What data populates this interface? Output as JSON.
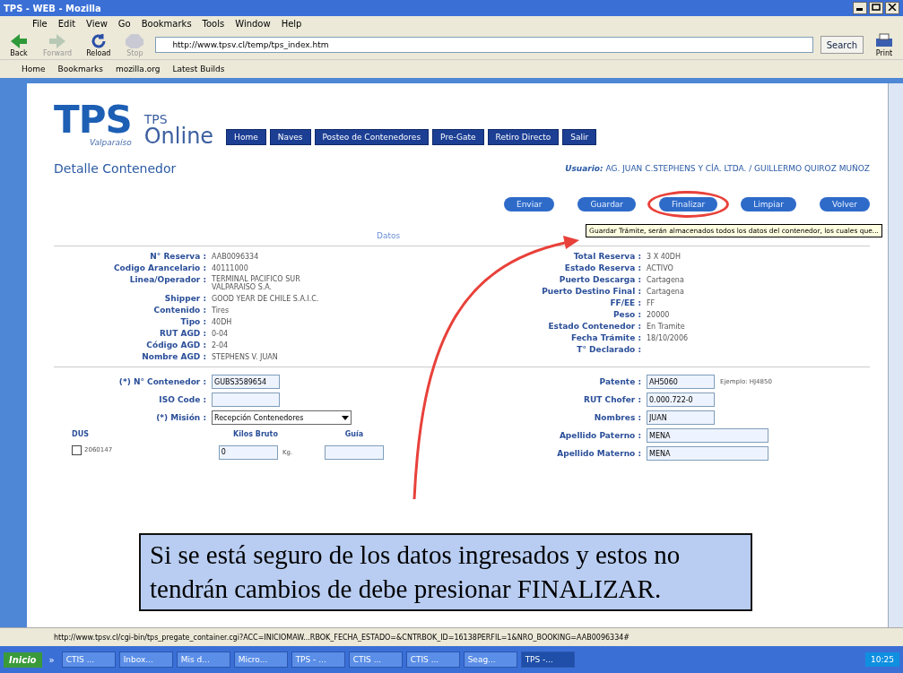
{
  "window": {
    "title": "TPS - WEB - Mozilla"
  },
  "menu": [
    "File",
    "Edit",
    "View",
    "Go",
    "Bookmarks",
    "Tools",
    "Window",
    "Help"
  ],
  "toolbar": {
    "buttons": [
      {
        "label": "Back",
        "kind": "back",
        "disabled": false
      },
      {
        "label": "Forward",
        "kind": "forward",
        "disabled": true
      },
      {
        "label": "Reload",
        "kind": "reload",
        "disabled": false
      },
      {
        "label": "Stop",
        "kind": "stop",
        "disabled": true
      }
    ],
    "url": "http://www.tpsv.cl/temp/tps_index.htm",
    "search": "Search",
    "print": "Print"
  },
  "bookmarks": [
    "Home",
    "Bookmarks",
    "mozilla.org",
    "Latest Builds"
  ],
  "page": {
    "logo": {
      "brand": "TPS",
      "city": "Valparaíso",
      "product_top": "TPS",
      "product_bottom": "Online"
    },
    "nav": [
      "Home",
      "Naves",
      "Posteo de Contenedores",
      "Pre-Gate",
      "Retiro Directo",
      "Salir"
    ],
    "heading": "Detalle Contenedor",
    "user": "**Usuario:** AG. JUAN C.STEPHENS Y CÍA. LTDA. / GUILLERMO QUIROZ MUÑOZ",
    "actions": [
      {
        "label": "Enviar",
        "circled": false
      },
      {
        "label": "Guardar",
        "circled": false
      },
      {
        "label": "Finalizar",
        "circled": true
      },
      {
        "label": "Limpiar",
        "circled": false
      },
      {
        "label": "Volver",
        "circled": false
      }
    ],
    "tooltip": "Guardar Trámite, serán almacenados todos los datos del contenedor, los cuales que...",
    "section": "Datos",
    "details_left": [
      {
        "label": "N° Reserva :",
        "value": "AAB0096334"
      },
      {
        "label": "Codigo Arancelario :",
        "value": "40111000"
      },
      {
        "label": "Linea/Operador :",
        "value": "TERMINAL PACIFICO SUR VALPARAISO S.A."
      },
      {
        "label": "Shipper :",
        "value": "GOOD YEAR DE CHILE S.A.I.C."
      },
      {
        "label": "Contenido :",
        "value": "Tires"
      },
      {
        "label": "Tipo :",
        "value": "40DH"
      },
      {
        "label": "RUT AGD :",
        "value": "0-04"
      },
      {
        "label": "Código AGD :",
        "value": "2-04"
      },
      {
        "label": "Nombre AGD :",
        "value": "STEPHENS V. JUAN"
      }
    ],
    "details_right": [
      {
        "label": "Total Reserva :",
        "value": "3 X 40DH"
      },
      {
        "label": "Estado Reserva :",
        "value": "ACTIVO"
      },
      {
        "label": "Puerto Descarga :",
        "value": "Cartagena"
      },
      {
        "label": "Puerto Destino Final :",
        "value": "Cartagena"
      },
      {
        "label": "FF/EE :",
        "value": "FF"
      },
      {
        "label": "Peso :",
        "value": "20000"
      },
      {
        "label": "Estado Contenedor :",
        "value": "En Tramite"
      },
      {
        "label": "Fecha Trámite :",
        "value": "18/10/2006"
      },
      {
        "label": "T° Declarado :"
      }
    ],
    "form_left": [
      {
        "label": "(*) N° Contenedor :",
        "kind": "input",
        "value": "GUBS3589654"
      },
      {
        "label": "ISO Code :",
        "kind": "input"
      },
      {
        "label": "(*) Misión :",
        "kind": "select",
        "value": "Recepción Contenedores"
      }
    ],
    "form_right": [
      {
        "label": "Patente :",
        "value": "AH5060",
        "hint": "Ejemplo: HJ4850"
      },
      {
        "label": "RUT Chofer :",
        "value": "0.000.722-0"
      },
      {
        "label": "Nombres :",
        "value": "JUAN"
      },
      {
        "label": "Apellido Paterno :",
        "value": "MENA"
      },
      {
        "label": "Apellido Materno :",
        "value": "MENA"
      }
    ],
    "dus": {
      "header": "DUS",
      "kilos_header": "Kilos Bruto",
      "guia_header": "Guía",
      "item": "2060147",
      "checked": false,
      "kilos": "0",
      "unit": "Kg."
    }
  },
  "caption": "Si se está seguro de los datos ingresados y estos no tendrán cambios de debe presionar FINALIZAR.",
  "status_bar": "http://www.tpsv.cl/cgi-bin/tps_pregate_container.cgi?ACC=INICIOMAW...RBOK_FECHA_ESTADO=&CNTRBOK_ID=16138PERFIL=1&NRO_BOOKING=AAB0096334#",
  "taskbar": {
    "start": "Inicio",
    "more": "»",
    "tasks": [
      {
        "label": "CTIS ...",
        "selected": false
      },
      {
        "label": "Inbox...",
        "selected": false
      },
      {
        "label": "Mis d...",
        "selected": false
      },
      {
        "label": "Micro...",
        "selected": false
      },
      {
        "label": "TPS - ...",
        "selected": false
      },
      {
        "label": "CTIS ...",
        "selected": false
      },
      {
        "label": "CTIS ...",
        "selected": false
      },
      {
        "label": "Seag...",
        "selected": false
      },
      {
        "label": "TPS -...",
        "selected": true
      }
    ],
    "clock": "10:25"
  }
}
